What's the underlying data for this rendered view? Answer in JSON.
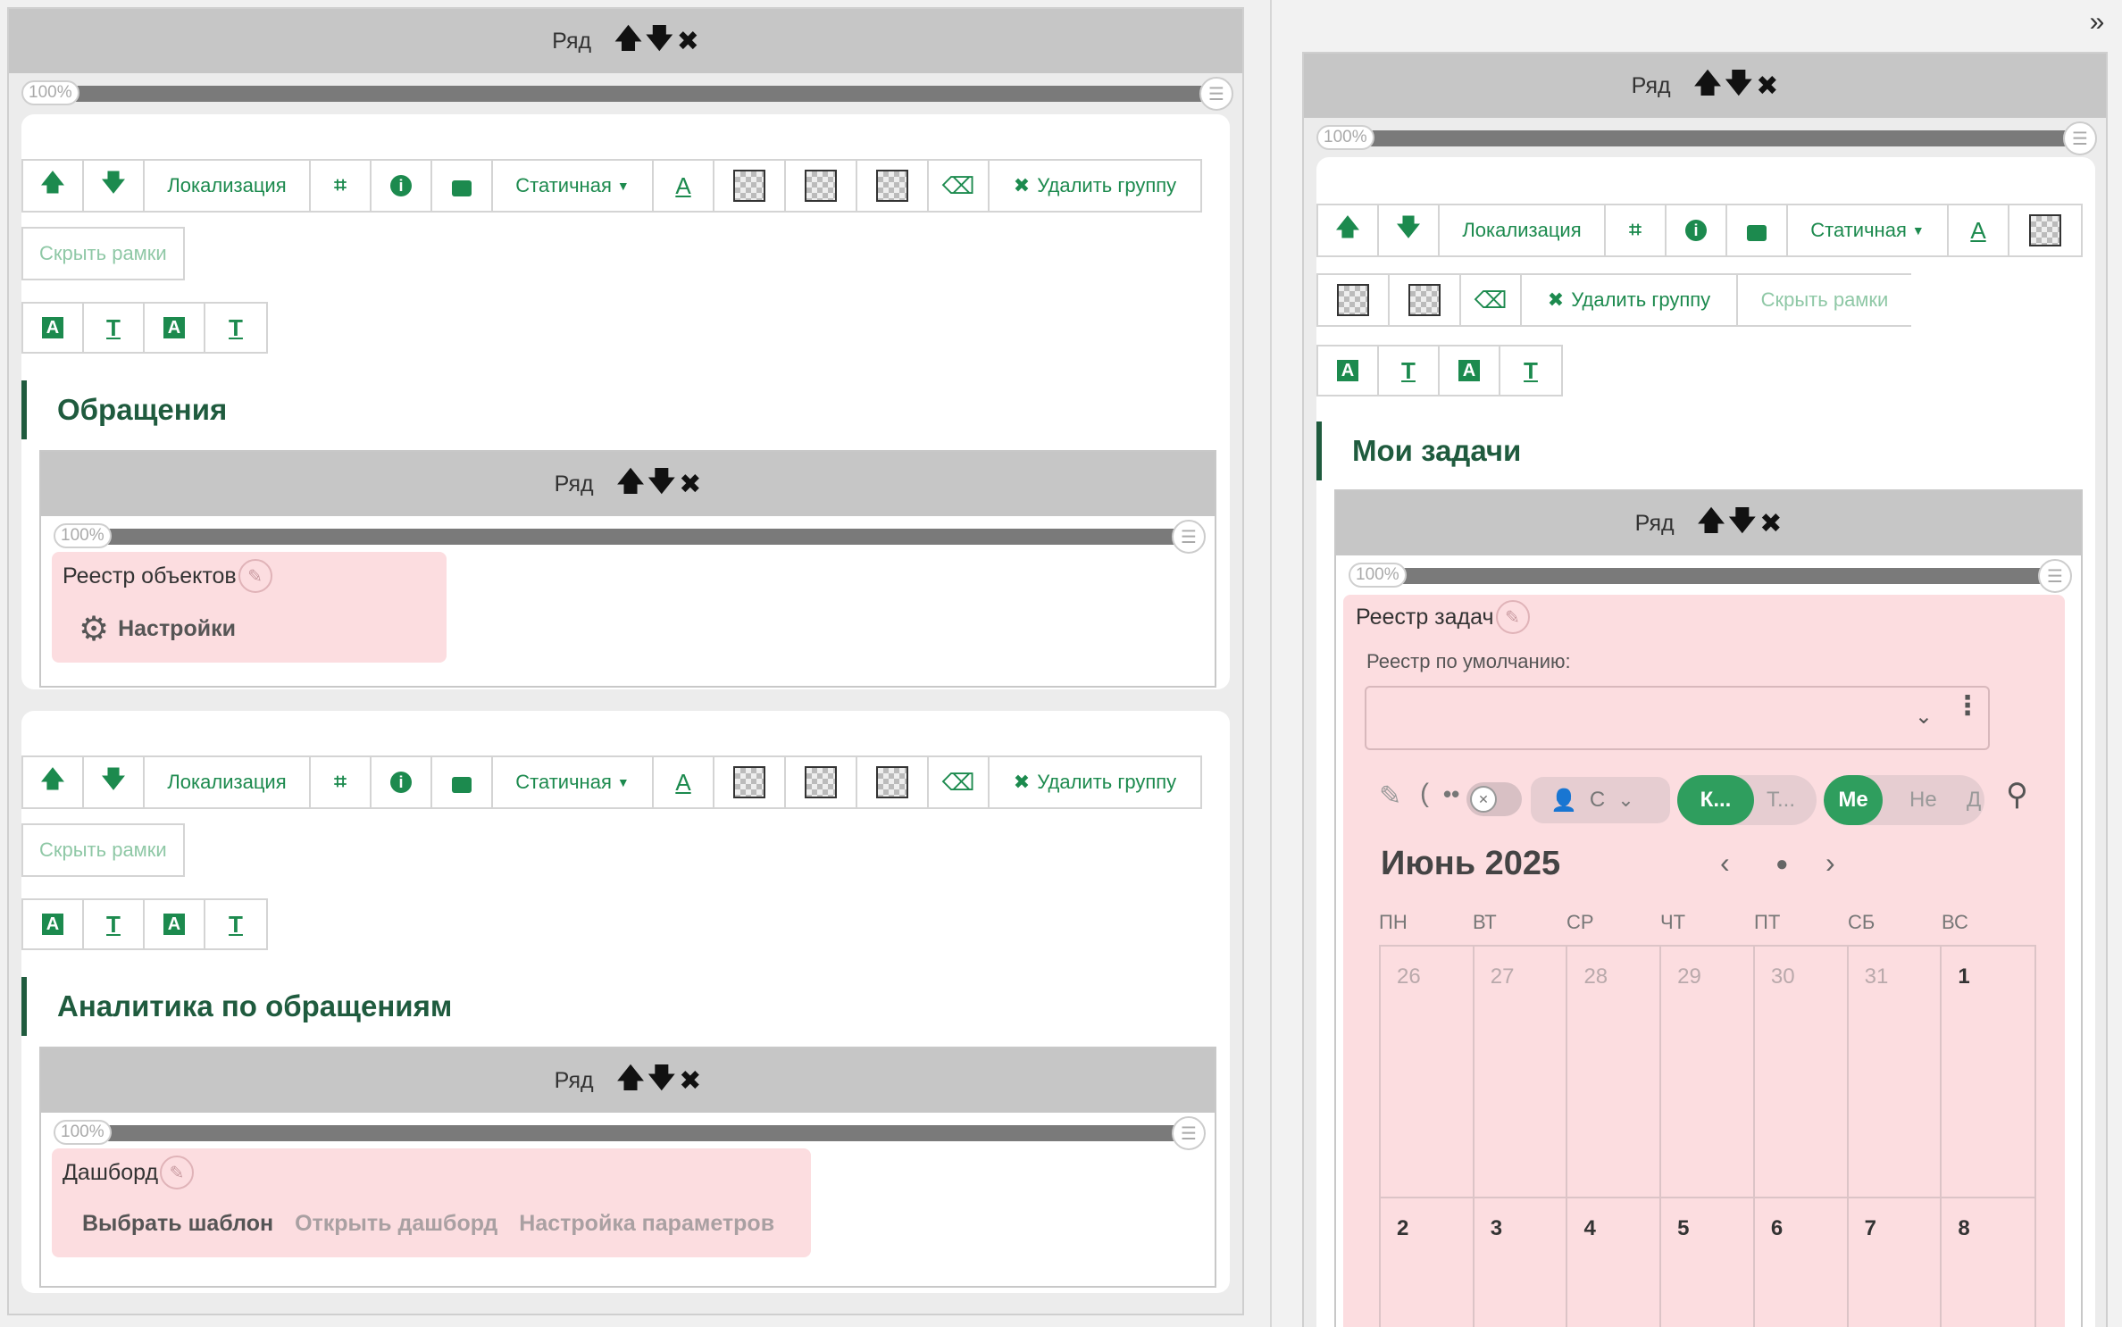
{
  "common": {
    "row_label": "Ряд",
    "progress_label": "100%",
    "toolbar": {
      "localization": "Локализация",
      "static": "Статичная",
      "delete_group": "Удалить группу",
      "hide_frames": "Скрыть рамки"
    }
  },
  "left": {
    "group1": {
      "title": "Обращения",
      "widget_title": "Реестр объектов",
      "settings_label": "Настройки"
    },
    "group2": {
      "title": "Аналитика по обращениям",
      "widget_title": "Дашборд",
      "actions": [
        "Выбрать шаблон",
        "Открыть дашборд",
        "Настройка параметров"
      ]
    }
  },
  "right": {
    "collapse_icon": "»",
    "group": {
      "title": "Мои задачи",
      "widget_title": "Реестр задач",
      "default_registry_label": "Реестр по умолчанию:",
      "filter": {
        "user_short": "С",
        "pill1_a": "К...",
        "pill1_b": "Т...",
        "pill2_a": "Ме",
        "pill2_b": "Не",
        "pill2_c": "Д"
      },
      "calendar": {
        "month": "Июнь 2025",
        "weekdays": [
          "ПН",
          "ВТ",
          "СР",
          "ЧТ",
          "ПТ",
          "СБ",
          "ВС"
        ],
        "week1": [
          "26",
          "27",
          "28",
          "29",
          "30",
          "31",
          "1"
        ],
        "week2": [
          "2",
          "3",
          "4",
          "5",
          "6",
          "7",
          "8"
        ]
      }
    }
  },
  "colors": {
    "accent": "#1c8a4e",
    "title": "#1f5b3e",
    "widget_bg": "#fcdde0",
    "row_bar": "#c6c6c6"
  }
}
